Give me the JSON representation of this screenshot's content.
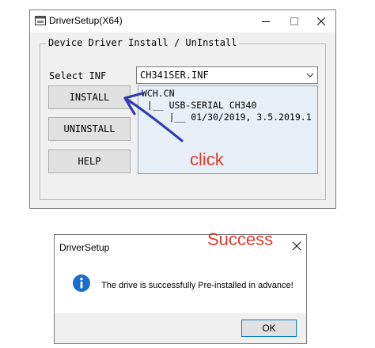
{
  "main_window": {
    "title": "DriverSetup(X64)",
    "controls": [
      "minimize-icon",
      "maximize-icon",
      "close-icon"
    ],
    "group_label": "Device Driver Install / UnInstall",
    "select_inf_label": "Select INF",
    "select_inf_value": "CH341SER.INF",
    "buttons": {
      "install": "INSTALL",
      "uninstall": "UNINSTALL",
      "help": "HELP"
    },
    "info_lines": [
      "WCH.CN",
      " |__ USB-SERIAL CH340",
      "     |__ 01/30/2019, 3.5.2019.1"
    ]
  },
  "annotations": {
    "click": "click",
    "success": "Success",
    "color": "#e03a2e",
    "arrow_color": "#2f3bb3"
  },
  "dialog": {
    "title": "DriverSetup",
    "message": "The drive is successfully Pre-installed in advance!",
    "ok_label": "OK",
    "icon": "info-icon"
  }
}
